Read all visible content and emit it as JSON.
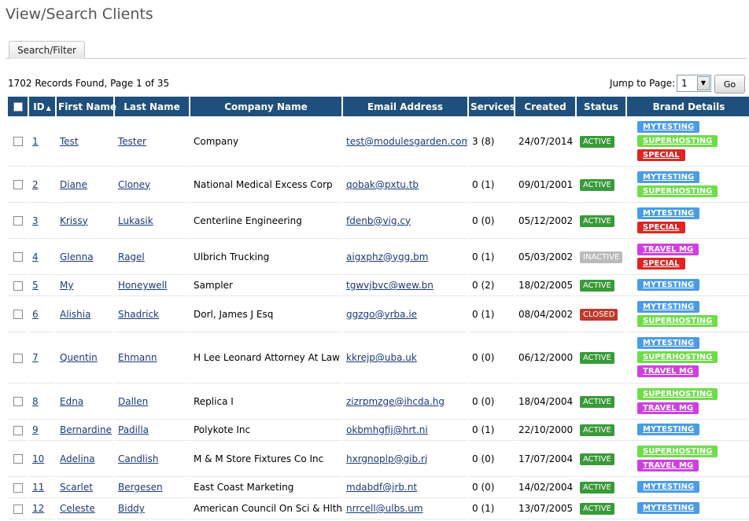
{
  "page": {
    "title": "View/Search Clients"
  },
  "tabs": [
    {
      "label": "Search/Filter"
    }
  ],
  "records_text": "1702 Records Found, Page 1 of 35",
  "jump": {
    "label": "Jump to Page:",
    "value": "1",
    "go": "Go"
  },
  "colors": {
    "header_bg": "#1f4f7d",
    "active": "#3a9a3a",
    "inactive": "#bbbbbb",
    "closed": "#c0392b",
    "link": "#1a3a7b"
  },
  "columns": [
    "ID",
    "First Name",
    "Last Name",
    "Company Name",
    "Email Address",
    "Services",
    "Created",
    "Status",
    "Brand Details"
  ],
  "brand_colors": {
    "MYTESTING": "#4a9be8",
    "SUPERHOSTING": "#6fdc4a",
    "SPECIAL": "#e02424",
    "TRAVEL MG": "#d13ee0"
  },
  "status_colors": {
    "ACTIVE": "#3a9a3a",
    "INACTIVE": "#bbbbbb",
    "CLOSED": "#c0392b"
  },
  "rows": [
    {
      "id": "1",
      "first": "Test",
      "last": "Tester",
      "company": "Company",
      "email": "test@modulesgarden.com",
      "services": "3 (8)",
      "created": "24/07/2014",
      "status": "ACTIVE",
      "brands": [
        "MYTESTING",
        "SUPERHOSTING",
        "SPECIAL"
      ]
    },
    {
      "id": "2",
      "first": "Diane",
      "last": "Cloney",
      "company": "National Medical Excess Corp",
      "email": "qobak@pxtu.tb",
      "services": "0 (1)",
      "created": "09/01/2001",
      "status": "ACTIVE",
      "brands": [
        "MYTESTING",
        "SUPERHOSTING"
      ]
    },
    {
      "id": "3",
      "first": "Krissy",
      "last": "Lukasik",
      "company": "Centerline Engineering",
      "email": "fdenb@vig.cy",
      "services": "0 (0)",
      "created": "05/12/2002",
      "status": "ACTIVE",
      "brands": [
        "MYTESTING",
        "SPECIAL"
      ]
    },
    {
      "id": "4",
      "first": "Glenna",
      "last": "Ragel",
      "company": "Ulbrich Trucking",
      "email": "aigxphz@ygg.bm",
      "services": "0 (1)",
      "created": "05/03/2002",
      "status": "INACTIVE",
      "brands": [
        "TRAVEL MG",
        "SPECIAL"
      ]
    },
    {
      "id": "5",
      "first": "My",
      "last": "Honeywell",
      "company": "Sampler",
      "email": "tgwvjbvc@wew.bn",
      "services": "0 (2)",
      "created": "18/02/2005",
      "status": "ACTIVE",
      "brands": [
        "MYTESTING"
      ]
    },
    {
      "id": "6",
      "first": "Alishia",
      "last": "Shadrick",
      "company": "Dorl, James J Esq",
      "email": "ggzgo@yrba.ie",
      "services": "0 (1)",
      "created": "08/04/2002",
      "status": "CLOSED",
      "brands": [
        "MYTESTING",
        "SUPERHOSTING"
      ]
    },
    {
      "id": "7",
      "first": "Quentin",
      "last": "Ehmann",
      "company": "H Lee Leonard Attorney At Law",
      "email": "kkrejp@uba.uk",
      "services": "0 (0)",
      "created": "06/12/2000",
      "status": "ACTIVE",
      "brands": [
        "MYTESTING",
        "SUPERHOSTING",
        "TRAVEL MG"
      ]
    },
    {
      "id": "8",
      "first": "Edna",
      "last": "Dallen",
      "company": "Replica I",
      "email": "zizrpmzge@ihcda.hg",
      "services": "0 (0)",
      "created": "18/04/2004",
      "status": "ACTIVE",
      "brands": [
        "SUPERHOSTING",
        "TRAVEL MG"
      ]
    },
    {
      "id": "9",
      "first": "Bernardine",
      "last": "Padilla",
      "company": "Polykote Inc",
      "email": "okbmhgfij@hrt.ni",
      "services": "0 (1)",
      "created": "22/10/2000",
      "status": "ACTIVE",
      "brands": [
        "MYTESTING"
      ]
    },
    {
      "id": "10",
      "first": "Adelina",
      "last": "Candlish",
      "company": "M & M Store Fixtures Co Inc",
      "email": "hxrgnoplp@gib.rj",
      "services": "0 (0)",
      "created": "17/07/2004",
      "status": "ACTIVE",
      "brands": [
        "SUPERHOSTING",
        "TRAVEL MG"
      ]
    },
    {
      "id": "11",
      "first": "Scarlet",
      "last": "Bergesen",
      "company": "East Coast Marketing",
      "email": "mdabdf@jrb.nt",
      "services": "0 (0)",
      "created": "14/02/2004",
      "status": "ACTIVE",
      "brands": [
        "MYTESTING"
      ]
    },
    {
      "id": "12",
      "first": "Celeste",
      "last": "Biddy",
      "company": "American Council On Sci & Hlth",
      "email": "nrrcell@ulbs.um",
      "services": "0 (1)",
      "created": "13/07/2005",
      "status": "ACTIVE",
      "brands": [
        "MYTESTING"
      ]
    }
  ]
}
